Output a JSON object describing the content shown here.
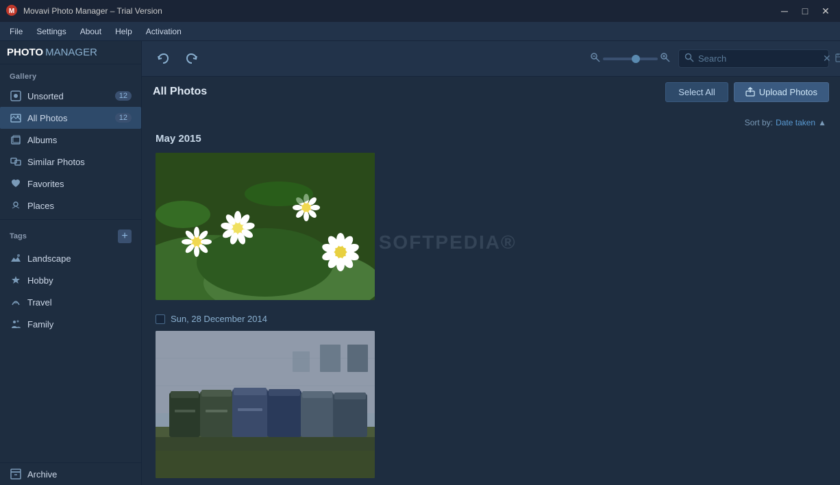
{
  "titlebar": {
    "title": "Movavi Photo Manager – Trial Version",
    "minimize": "─",
    "maximize": "□",
    "close": "✕"
  },
  "menubar": {
    "items": [
      "File",
      "Settings",
      "About",
      "Help",
      "Activation"
    ]
  },
  "toolbar": {
    "logo_photo": "PHOTO",
    "logo_manager": "MANAGER",
    "undo_label": "↩",
    "redo_label": "↪"
  },
  "search": {
    "placeholder": "Search"
  },
  "sidebar": {
    "gallery_label": "Gallery",
    "items": [
      {
        "id": "unsorted",
        "label": "Unsorted",
        "count": "12",
        "active": false
      },
      {
        "id": "all-photos",
        "label": "All Photos",
        "count": "12",
        "active": true
      },
      {
        "id": "albums",
        "label": "Albums",
        "count": "",
        "active": false
      },
      {
        "id": "similar-photos",
        "label": "Similar Photos",
        "count": "",
        "active": false
      },
      {
        "id": "favorites",
        "label": "Favorites",
        "count": "",
        "active": false
      },
      {
        "id": "places",
        "label": "Places",
        "count": "",
        "active": false
      }
    ],
    "tags_label": "Tags",
    "tags_add": "+",
    "tag_items": [
      {
        "id": "landscape",
        "label": "Landscape"
      },
      {
        "id": "hobby",
        "label": "Hobby"
      },
      {
        "id": "travel",
        "label": "Travel"
      },
      {
        "id": "family",
        "label": "Family"
      }
    ],
    "archive_label": "Archive"
  },
  "content": {
    "page_title": "All Photos",
    "select_all_label": "Select All",
    "upload_label": "Upload Photos",
    "sort_by": "Sort by:",
    "sort_value": "Date taken",
    "sections": [
      {
        "id": "may-2015",
        "month_label": "May 2015",
        "photos": [
          {
            "id": "daisies",
            "type": "daisies",
            "alt": "Daisy flowers"
          }
        ]
      },
      {
        "id": "dec-2014",
        "date_label": "Sun, 28 December 2014",
        "photos": [
          {
            "id": "trash-bins",
            "type": "trash",
            "alt": "Trash bins"
          }
        ]
      }
    ]
  }
}
